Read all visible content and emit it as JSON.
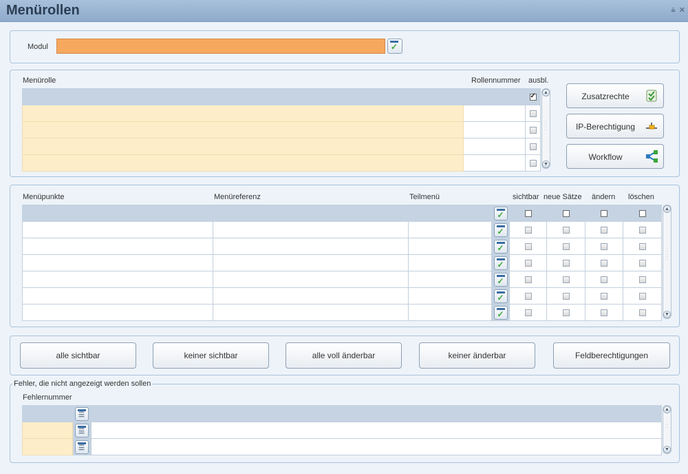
{
  "window": {
    "title": "Menürollen",
    "controls": [
      "⩮",
      "✕"
    ]
  },
  "modul": {
    "label": "Modul",
    "value": ""
  },
  "menurolle": {
    "col_name": "Menürolle",
    "col_number": "Rollennummer",
    "col_hidden": "ausbl.",
    "rows": [
      {
        "name": "",
        "number": "",
        "hidden": true
      },
      {
        "name": "",
        "number": "",
        "hidden": false
      },
      {
        "name": "",
        "number": "",
        "hidden": false
      },
      {
        "name": "",
        "number": "",
        "hidden": false
      },
      {
        "name": "",
        "number": "",
        "hidden": false
      }
    ],
    "buttons": [
      {
        "label": "Zusatzrechte",
        "icon": "checklist-icon"
      },
      {
        "label": "IP-Berechtigung",
        "icon": "network-icon"
      },
      {
        "label": "Workflow",
        "icon": "workflow-icon"
      }
    ]
  },
  "menupunkte": {
    "col_item": "Menüpunkte",
    "col_ref": "Menüreferenz",
    "col_sub": "Teilmenü",
    "col_visible": "sichtbar",
    "col_new": "neue Sätze",
    "col_change": "ändern",
    "col_delete": "löschen",
    "row_count": 7
  },
  "actions": {
    "all_visible": "alle sichtbar",
    "none_visible": "keiner sichtbar",
    "all_editable": "alle voll änderbar",
    "none_editable": "keiner änderbar",
    "field_permissions": "Feldberechtigungen"
  },
  "errors": {
    "legend": "Fehler, die nicht angezeigt werden sollen",
    "col_number": "Fehlernummer",
    "row_count": 3
  }
}
